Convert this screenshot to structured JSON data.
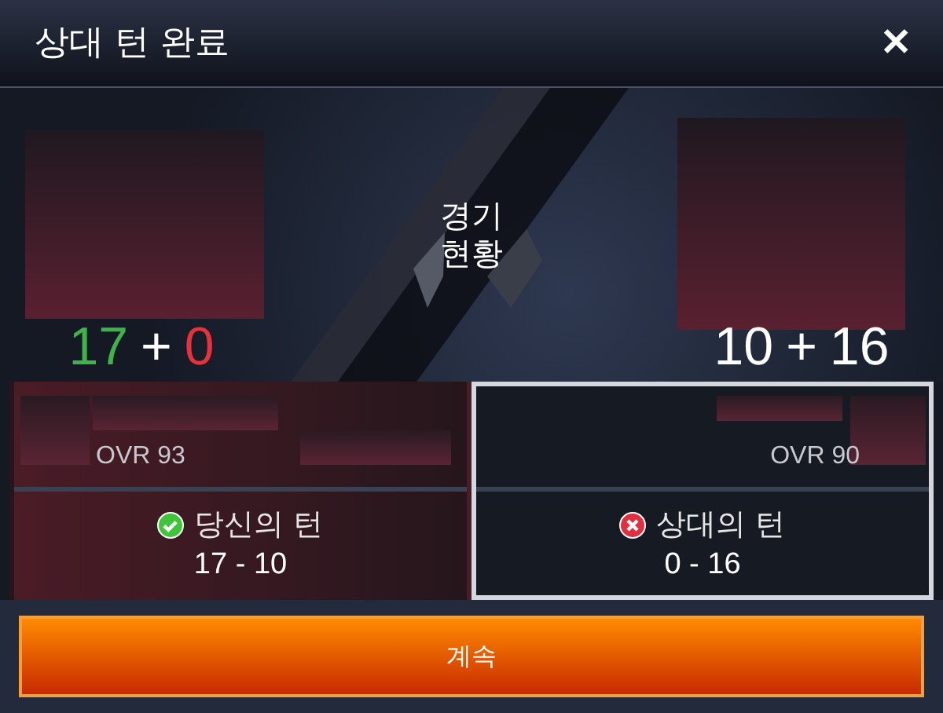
{
  "title": "상대 턴 완료",
  "close": "✕",
  "center_label": "경기\n현황",
  "sides": [
    {
      "score": [
        {
          "text": "17",
          "kind": "good"
        },
        {
          "text": "+",
          "kind": "plain"
        },
        {
          "text": "0",
          "kind": "bad"
        }
      ],
      "ovr": "OVR 93",
      "selected": false,
      "passed": true,
      "turn_label": "당신의 턴",
      "turn_score": "17 - 10"
    },
    {
      "score": [
        {
          "text": "10",
          "kind": "plain"
        },
        {
          "text": "+",
          "kind": "plain"
        },
        {
          "text": "16",
          "kind": "plain"
        }
      ],
      "ovr": "OVR 90",
      "selected": true,
      "passed": false,
      "turn_label": "상대의 턴",
      "turn_score": "0 - 16"
    }
  ],
  "button": "계속"
}
